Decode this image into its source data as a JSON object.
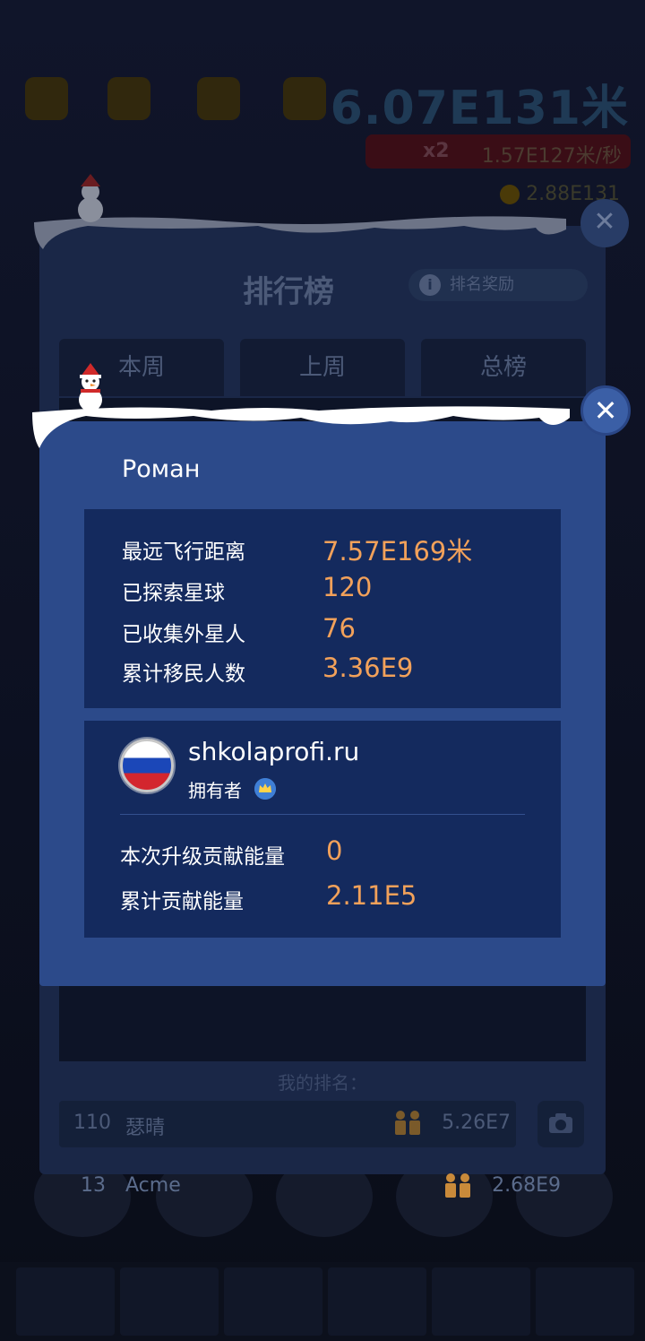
{
  "hud": {
    "distance": "6.07E131米",
    "boost_multiplier": "x2",
    "boost_rate": "1.57E127米/秒",
    "coins": "2.88E131"
  },
  "leaderboard": {
    "title": "排行榜",
    "reward_button": "排名奖励",
    "tabs": [
      "本周",
      "上周",
      "总榜"
    ],
    "rows": [
      {
        "rank": "13",
        "name": "Acme",
        "value": "2.68E9"
      }
    ],
    "my_rank_label": "我的排名：",
    "my_rank": {
      "rank": "110",
      "name": "瑟晴",
      "value": "5.26E7"
    }
  },
  "player_card": {
    "name": "Роман",
    "stats": [
      {
        "label": "最远飞行距离",
        "value": "7.57E169米"
      },
      {
        "label": "已探索星球",
        "value": "120"
      },
      {
        "label": "已收集外星人",
        "value": "76"
      },
      {
        "label": "累计移民人数",
        "value": "3.36E9"
      }
    ],
    "owner": {
      "site": "shkolaprofi.ru",
      "role": "拥有者",
      "flag": "russia-flag",
      "energy": [
        {
          "label": "本次升级贡献能量",
          "value": "0"
        },
        {
          "label": "累计贡献能量",
          "value": "2.11E5"
        }
      ]
    }
  },
  "colors": {
    "modal_bg": "#2c4a8a",
    "stats_bg": "#142a5e",
    "value_orange": "#f2a15a"
  }
}
